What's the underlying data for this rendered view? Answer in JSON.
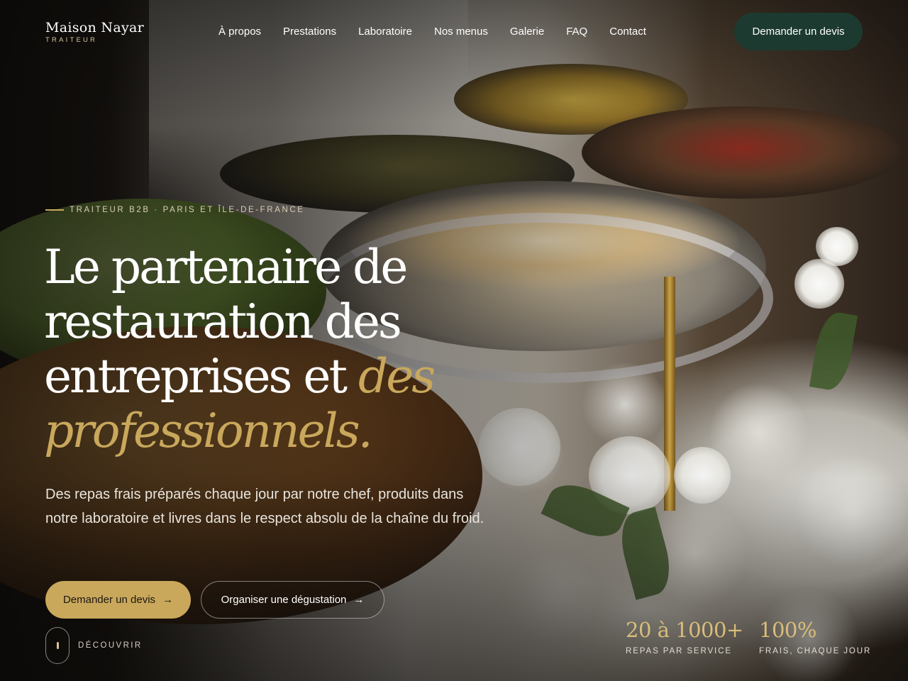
{
  "brand": {
    "name": "Maison Nayar",
    "tagline": "TRAITEUR"
  },
  "nav": {
    "items": [
      {
        "label": "À propos"
      },
      {
        "label": "Prestations"
      },
      {
        "label": "Laboratoire"
      },
      {
        "label": "Nos menus"
      },
      {
        "label": "Galerie"
      },
      {
        "label": "FAQ"
      },
      {
        "label": "Contact"
      }
    ],
    "cta_label": "Demander un devis"
  },
  "hero": {
    "eyebrow": "TRAITEUR B2B · PARIS ET ÎLE-DE-FRANCE",
    "headline_main": "Le partenaire de restauration des entreprises et ",
    "headline_accent": "des professionnels.",
    "lead": "Des repas frais préparés chaque jour par notre chef, produits dans notre laboratoire et livres dans le respect absolu de la chaîne du froid.",
    "primary_cta": "Demander un devis",
    "secondary_cta": "Organiser une dégustation",
    "scroll_label": "DÉCOUVRIR"
  },
  "stats": [
    {
      "value": "20 à 1000+",
      "label": "REPAS PAR SERVICE"
    },
    {
      "value": "100%",
      "label": "FRAIS, CHAQUE JOUR"
    }
  ],
  "colors": {
    "accent_gold": "#c9a85c",
    "header_cta_green": "#1c3a30"
  },
  "icons": {
    "arrow": "arrow-right-icon",
    "scroll": "mouse-scroll-icon"
  }
}
